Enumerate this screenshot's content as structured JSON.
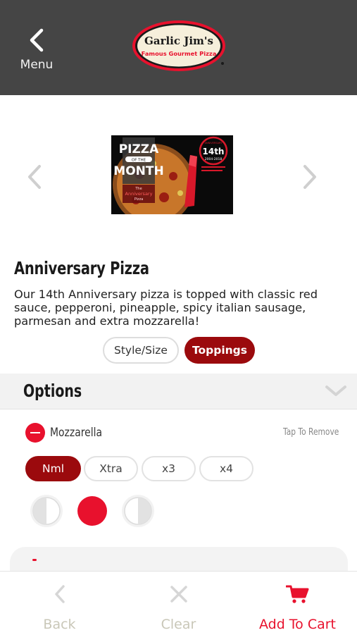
{
  "header": {
    "menu_label": "Menu",
    "logo_line1": "Garlic Jim's",
    "logo_line2": "Famous Gourmet Pizza"
  },
  "promo": {
    "headline_1": "PIZZA",
    "headline_of": "OF THE",
    "headline_2": "MONTH",
    "sub_1": "The",
    "sub_2": "Anniversary",
    "sub_3": "Pizza",
    "badge_top": "ANNIVERSARY",
    "badge_num": "14th",
    "badge_years": "2004-2018"
  },
  "product": {
    "title": "Anniversary Pizza",
    "description": "Our 14th Anniversary pizza is topped with classic red sauce, pepperoni, pineapple, spicy italian sausage, parmesan and extra mozzarella!"
  },
  "segments": {
    "style_size": "Style/Size",
    "toppings": "Toppings"
  },
  "options": {
    "title": "Options"
  },
  "topping": {
    "name": "Mozzarella",
    "tap_hint": "Tap To Remove",
    "amounts": [
      "Nml",
      "Xtra",
      "x3",
      "x4"
    ],
    "selected_amount": "Nml",
    "selected_side": "whole"
  },
  "bottom_bar": {
    "back": "Back",
    "clear": "Clear",
    "add_to_cart": "Add To Cart"
  },
  "colors": {
    "header_bg": "#454545",
    "brand_red": "#e8112d",
    "dark_red": "#9b0a0d",
    "muted": "#c9c7b8"
  }
}
